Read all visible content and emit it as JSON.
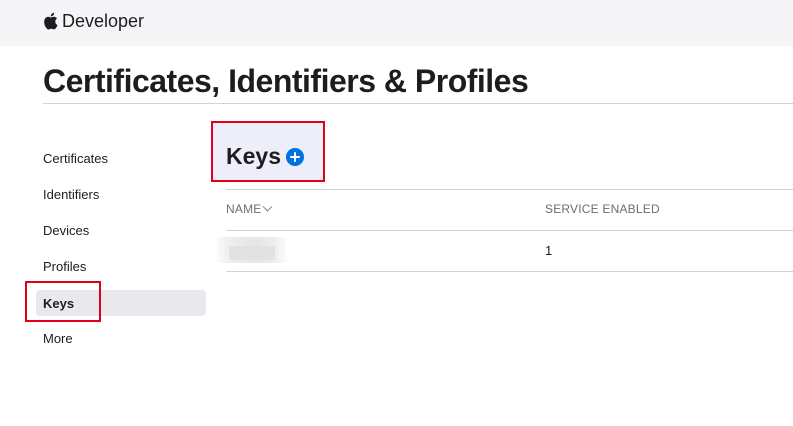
{
  "header": {
    "brand_label": "Developer"
  },
  "page": {
    "title": "Certificates, Identifiers & Profiles"
  },
  "sidebar": {
    "items": [
      {
        "label": "Certificates"
      },
      {
        "label": "Identifiers"
      },
      {
        "label": "Devices"
      },
      {
        "label": "Profiles"
      },
      {
        "label": "Keys",
        "active": true
      },
      {
        "label": "More"
      }
    ]
  },
  "section": {
    "title": "Keys",
    "add_icon": "plus-circle-icon"
  },
  "table": {
    "columns": [
      "NAME",
      "SERVICE ENABLED"
    ],
    "rows": [
      {
        "name": "",
        "services_enabled": "1"
      }
    ]
  },
  "colors": {
    "accent": "#0071e3",
    "highlight": "#e0001b",
    "active_bg": "#e8e8ed"
  }
}
